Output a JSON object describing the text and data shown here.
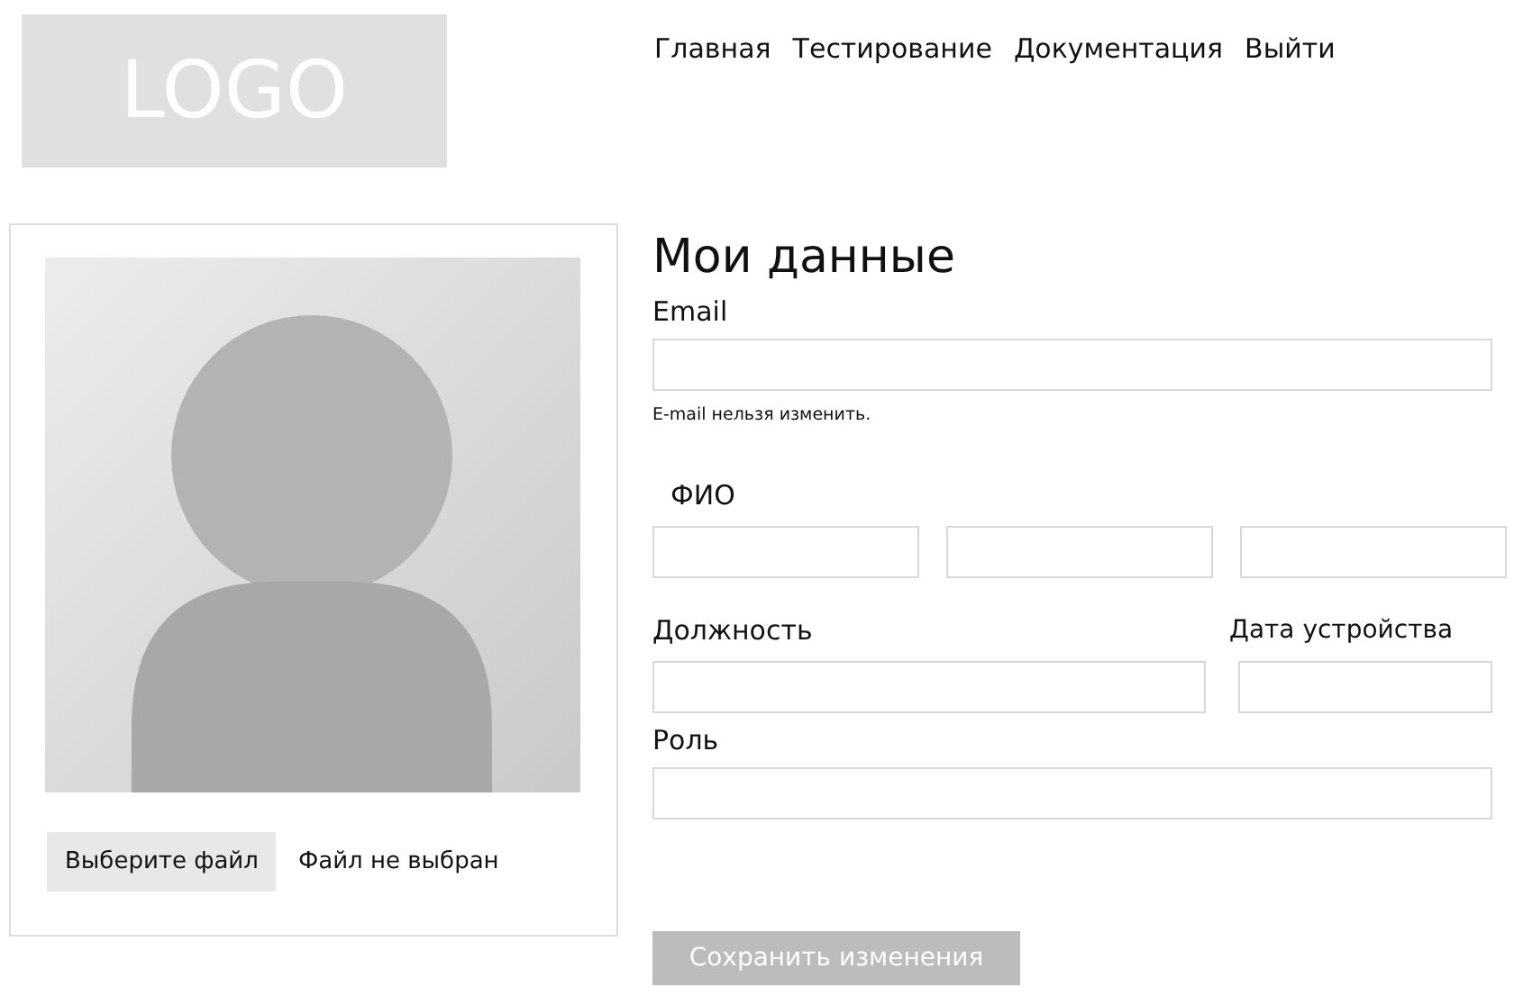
{
  "logo": {
    "text": "LOGO"
  },
  "nav": [
    {
      "label": "Главная"
    },
    {
      "label": "Тестирование"
    },
    {
      "label": "Документация"
    },
    {
      "label": "Выйти"
    }
  ],
  "profile_card": {
    "file_button": "Выберите файл",
    "file_status": "Файл не выбран"
  },
  "form": {
    "title": "Мои данные",
    "email": {
      "label": "Email",
      "hint": "E-mail нельзя изменить."
    },
    "fio": {
      "label": "ФИО",
      "inputs": [
        {
          "kind": "text"
        },
        {
          "kind": "text"
        },
        {
          "kind": "text"
        }
      ]
    },
    "position": {
      "label": "Должность"
    },
    "start_date": {
      "label": "Дата устройства"
    },
    "role": {
      "label": "Роль"
    },
    "save_button": {
      "label": "Сохранить изменения",
      "disabled": true
    }
  }
}
